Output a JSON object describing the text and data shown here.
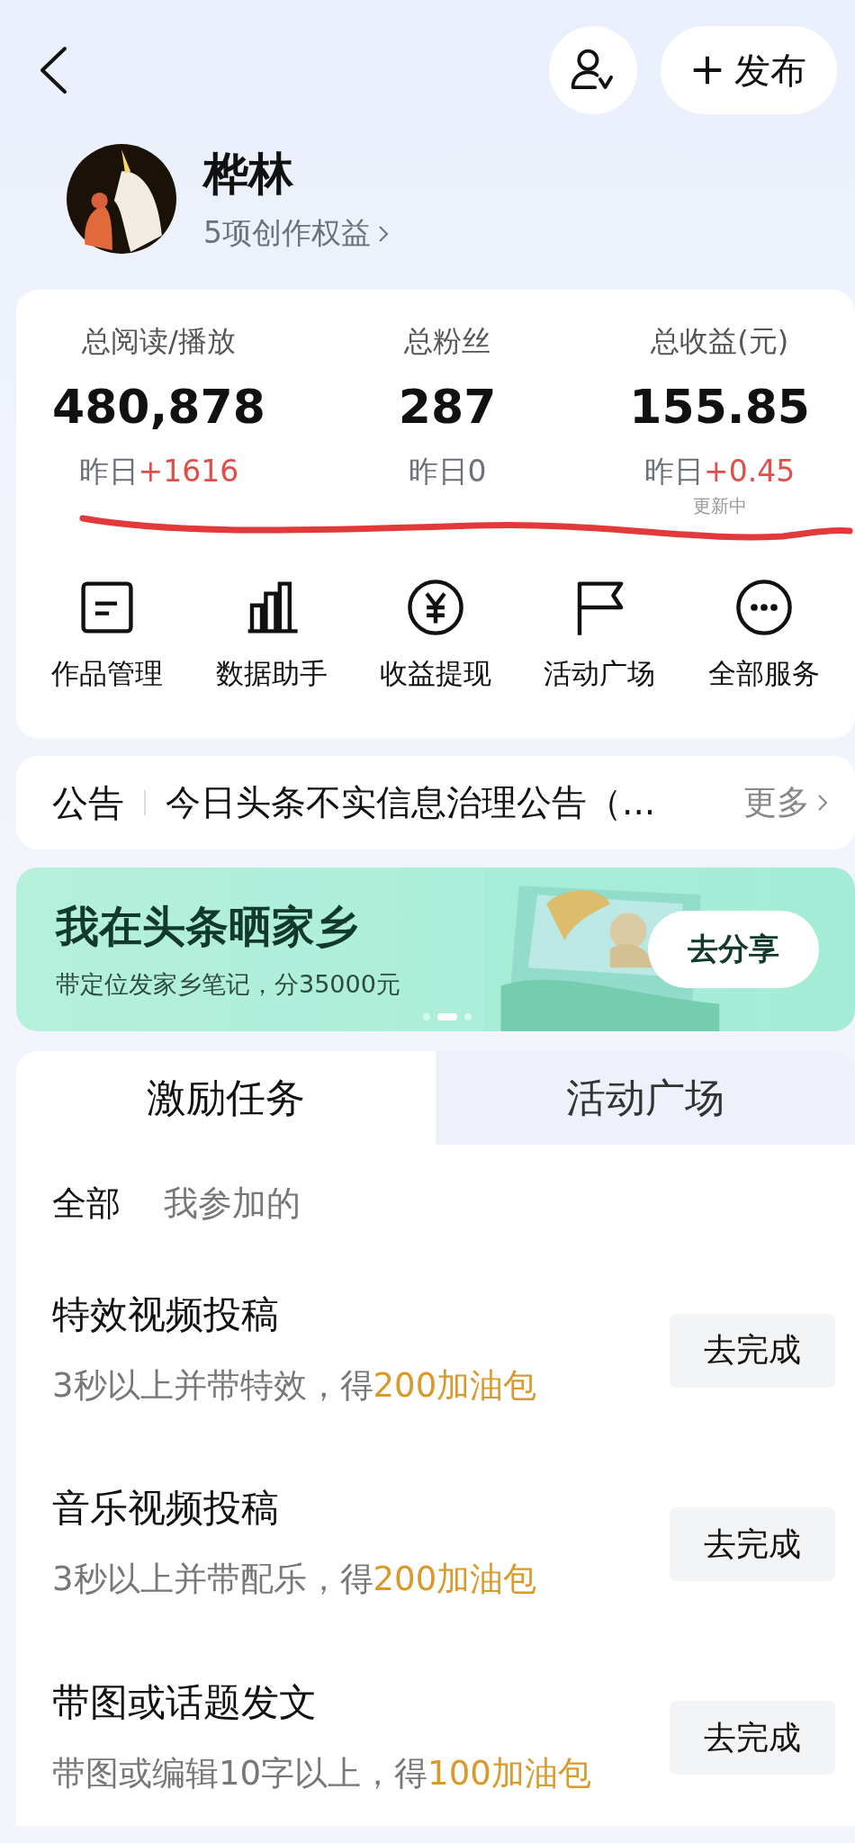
{
  "header": {
    "publish_label": "发布"
  },
  "profile": {
    "name": "桦林",
    "benefits": "5项创作权益"
  },
  "stats": [
    {
      "label": "总阅读/播放",
      "value": "480,878",
      "yesterday_label": "昨日",
      "yesterday_value": "+1616",
      "kind": "up"
    },
    {
      "label": "总粉丝",
      "value": "287",
      "yesterday_label": "昨日",
      "yesterday_value": "0",
      "kind": "flat"
    },
    {
      "label": "总收益(元)",
      "value": "155.85",
      "yesterday_label": "昨日",
      "yesterday_value": "+0.45",
      "kind": "up",
      "note": "更新中"
    }
  ],
  "services": [
    {
      "label": "作品管理",
      "kind": "document"
    },
    {
      "label": "数据助手",
      "kind": "bars"
    },
    {
      "label": "收益提现",
      "kind": "yuan"
    },
    {
      "label": "活动广场",
      "kind": "flag"
    },
    {
      "label": "全部服务",
      "kind": "more"
    }
  ],
  "notice": {
    "tag": "公告",
    "text": "今日头条不实信息治理公告（...",
    "more": "更多"
  },
  "banner": {
    "title": "我在头条晒家乡",
    "subtitle": "带定位发家乡笔记，分35000元",
    "button": "去分享",
    "dots": [
      {
        "selected": false
      },
      {
        "selected": true
      },
      {
        "selected": false
      }
    ]
  },
  "tabs": [
    {
      "label": "激励任务",
      "selected": true
    },
    {
      "label": "活动广场",
      "selected": false
    }
  ],
  "filters": [
    {
      "label": "全部",
      "selected": true
    },
    {
      "label": "我参加的",
      "selected": false
    }
  ],
  "tasks": [
    {
      "title": "特效视频投稿",
      "desc": "3秒以上并带特效，得",
      "reward": "200加油包",
      "button": "去完成"
    },
    {
      "title": "音乐视频投稿",
      "desc": "3秒以上并带配乐，得",
      "reward": "200加油包",
      "button": "去完成"
    },
    {
      "title": "带图或话题发文",
      "desc": "带图或编辑10字以上，得",
      "reward": "100加油包",
      "button": "去完成"
    }
  ]
}
